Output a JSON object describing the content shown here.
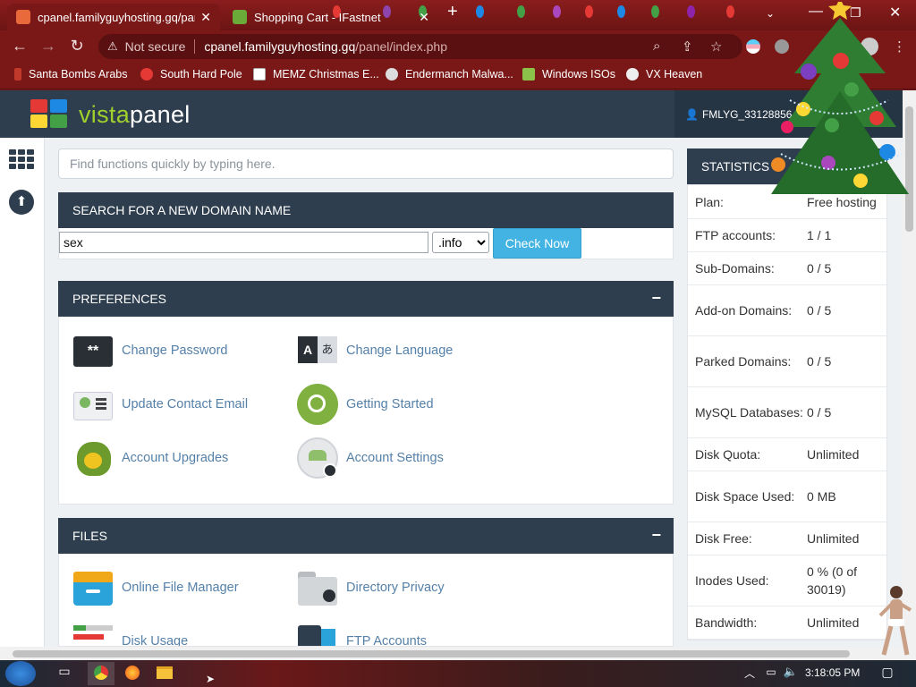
{
  "browser": {
    "tabs": [
      {
        "title": "cpanel.familyguyhosting.gq/panel",
        "active": true
      },
      {
        "title": "Shopping Cart - IFastnet",
        "active": false
      }
    ],
    "new_tab": "+",
    "address": {
      "security": "Not secure",
      "host": "cpanel.familyguyhosting.gq",
      "path": "/panel/index.php"
    },
    "bookmarks": [
      {
        "label": "Santa Bombs Arabs",
        "color": "#c0392b"
      },
      {
        "label": "South Hard Pole",
        "color": "#e53935"
      },
      {
        "label": "MEMZ Christmas E...",
        "color": "#ffffff"
      },
      {
        "label": "Endermanch Malwa...",
        "color": "#dddddd"
      },
      {
        "label": "Windows ISOs",
        "color": "#8bc34a"
      },
      {
        "label": "VX Heaven",
        "color": "#eeeeee"
      }
    ]
  },
  "header": {
    "logo_part1": "vista",
    "logo_part2": "panel",
    "user": "FMLYG_33128856"
  },
  "search": {
    "placeholder": "Find functions quickly by typing here."
  },
  "domain_search": {
    "title": "SEARCH FOR A NEW DOMAIN NAME",
    "value": "sex",
    "tld": ".info",
    "button": "Check Now"
  },
  "preferences": {
    "title": "PREFERENCES",
    "collapse": "−",
    "items": [
      {
        "label": "Change Password",
        "icon": "password-icon"
      },
      {
        "label": "Change Language",
        "icon": "language-icon"
      },
      {
        "label": "Update Contact Email",
        "icon": "contact-card-icon"
      },
      {
        "label": "Getting Started",
        "icon": "getting-started-icon"
      },
      {
        "label": "Account Upgrades",
        "icon": "dragon-icon"
      },
      {
        "label": "Account Settings",
        "icon": "account-settings-icon"
      }
    ]
  },
  "files": {
    "title": "FILES",
    "collapse": "−",
    "items": [
      {
        "label": "Online File Manager",
        "icon": "file-manager-icon"
      },
      {
        "label": "Directory Privacy",
        "icon": "folder-lock-icon"
      },
      {
        "label": "Disk Usage",
        "icon": "disk-usage-icon"
      },
      {
        "label": "FTP Accounts",
        "icon": "ftp-accounts-icon"
      }
    ]
  },
  "statistics": {
    "title": "STATISTICS",
    "rows": [
      {
        "key": "Plan:",
        "value": "Free hosting"
      },
      {
        "key": "FTP accounts:",
        "value": "1 / 1"
      },
      {
        "key": "Sub-Domains:",
        "value": "0 / 5"
      },
      {
        "key": "Add-on Domains:",
        "value": "0 / 5"
      },
      {
        "key": "Parked Domains:",
        "value": "0 / 5"
      },
      {
        "key": "MySQL Databases:",
        "value": "0 / 5"
      },
      {
        "key": "Disk Quota:",
        "value": "Unlimited"
      },
      {
        "key": "Disk Space Used:",
        "value": "0 MB"
      },
      {
        "key": "Disk Free:",
        "value": "Unlimited"
      },
      {
        "key": "Inodes Used:",
        "value": "0 % (0 of 30019)"
      },
      {
        "key": "Bandwidth:",
        "value": "Unlimited"
      }
    ]
  },
  "taskbar": {
    "clock": "3:18:05 PM"
  },
  "colors": {
    "accent": "#42b3e3",
    "header": "#2e3e4e",
    "link": "#5580a8",
    "logo_green": "#9fd02b"
  }
}
